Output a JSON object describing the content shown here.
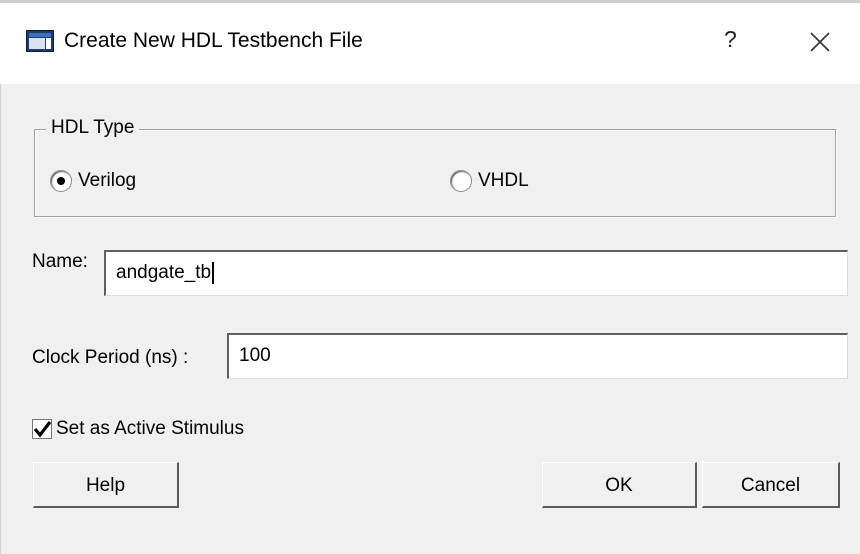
{
  "window": {
    "title": "Create New HDL Testbench File",
    "help_glyph": "?",
    "app_icon": "window-icon",
    "close_icon": "close-icon"
  },
  "hdl_type": {
    "group_label": "HDL Type",
    "options": [
      {
        "label": "Verilog",
        "selected": true
      },
      {
        "label": "VHDL",
        "selected": false
      }
    ]
  },
  "name": {
    "label": "Name:",
    "value": "andgate_tb"
  },
  "clock": {
    "label": "Clock Period (ns) :",
    "value": "100"
  },
  "active_stimulus": {
    "label": "Set as Active Stimulus",
    "checked": true
  },
  "buttons": {
    "help": "Help",
    "ok": "OK",
    "cancel": "Cancel"
  }
}
